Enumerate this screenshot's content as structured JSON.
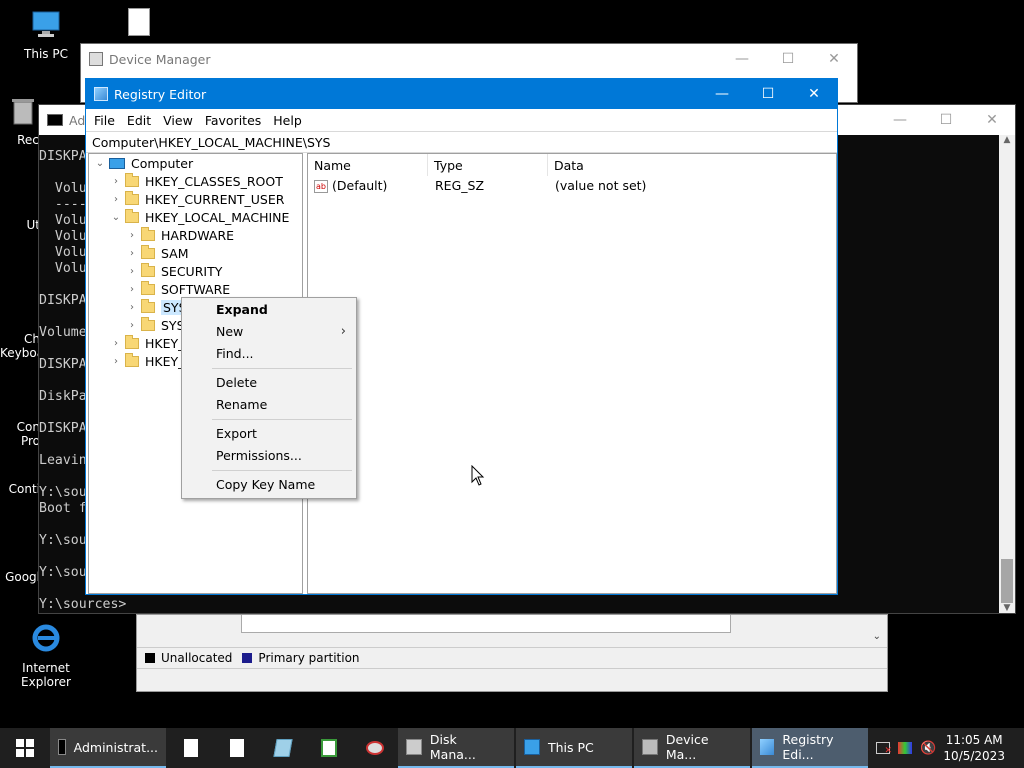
{
  "desktop": {
    "icons": [
      {
        "label": "This PC"
      },
      {
        "label": "Recy"
      },
      {
        "label": "Ut"
      },
      {
        "label": "Ch\nKeyboa"
      },
      {
        "label": "Con\nPro"
      },
      {
        "label": "Conti"
      },
      {
        "label": "Googl"
      },
      {
        "label": "Internet Explorer"
      }
    ]
  },
  "device_manager": {
    "title": "Device Manager"
  },
  "console": {
    "title": "Ad",
    "lines": "DISKPA\n\n  Volu\n  ----\n  Volu\n  Volu\n  Volu\n  Volu\n\nDISKPA\n\nVolume\n\nDISKPA\n\nDiskPa\n\nDISKPA\n\nLeavin\n\nY:\\sou\nBoot f\n\nY:\\sou\n\nY:\\sou\n\nY:\\sources>"
  },
  "regedit": {
    "title": "Registry Editor",
    "menu": [
      "File",
      "Edit",
      "View",
      "Favorites",
      "Help"
    ],
    "address": "Computer\\HKEY_LOCAL_MACHINE\\SYS",
    "tree": {
      "root": "Computer",
      "hkcr": "HKEY_CLASSES_ROOT",
      "hkcu": "HKEY_CURRENT_USER",
      "hklm": "HKEY_LOCAL_MACHINE",
      "hardware": "HARDWARE",
      "sam": "SAM",
      "security": "SECURITY",
      "software": "SOFTWARE",
      "sys": "SYS",
      "system": "SYST",
      "hku": "HKEY_U",
      "hkcc": "HKEY_C"
    },
    "columns": {
      "name": "Name",
      "type": "Type",
      "data": "Data"
    },
    "rows": [
      {
        "name": "(Default)",
        "type": "REG_SZ",
        "data": "(value not set)"
      }
    ]
  },
  "context_menu": {
    "expand": "Expand",
    "new": "New",
    "find": "Find...",
    "delete": "Delete",
    "rename": "Rename",
    "export": "Export",
    "permissions": "Permissions...",
    "copy_key_name": "Copy Key Name"
  },
  "disk_management": {
    "legend_unallocated": "Unallocated",
    "legend_primary": "Primary partition"
  },
  "taskbar": {
    "buttons": {
      "cmd": "Administrat...",
      "disk": "Disk Mana...",
      "thispc": "This PC",
      "devmgr": "Device Ma...",
      "regedit": "Registry Edi..."
    },
    "time": "11:05 AM",
    "date": "10/5/2023"
  },
  "colors": {
    "accent": "#0078d7",
    "taskbar": "#1f1f1f"
  }
}
